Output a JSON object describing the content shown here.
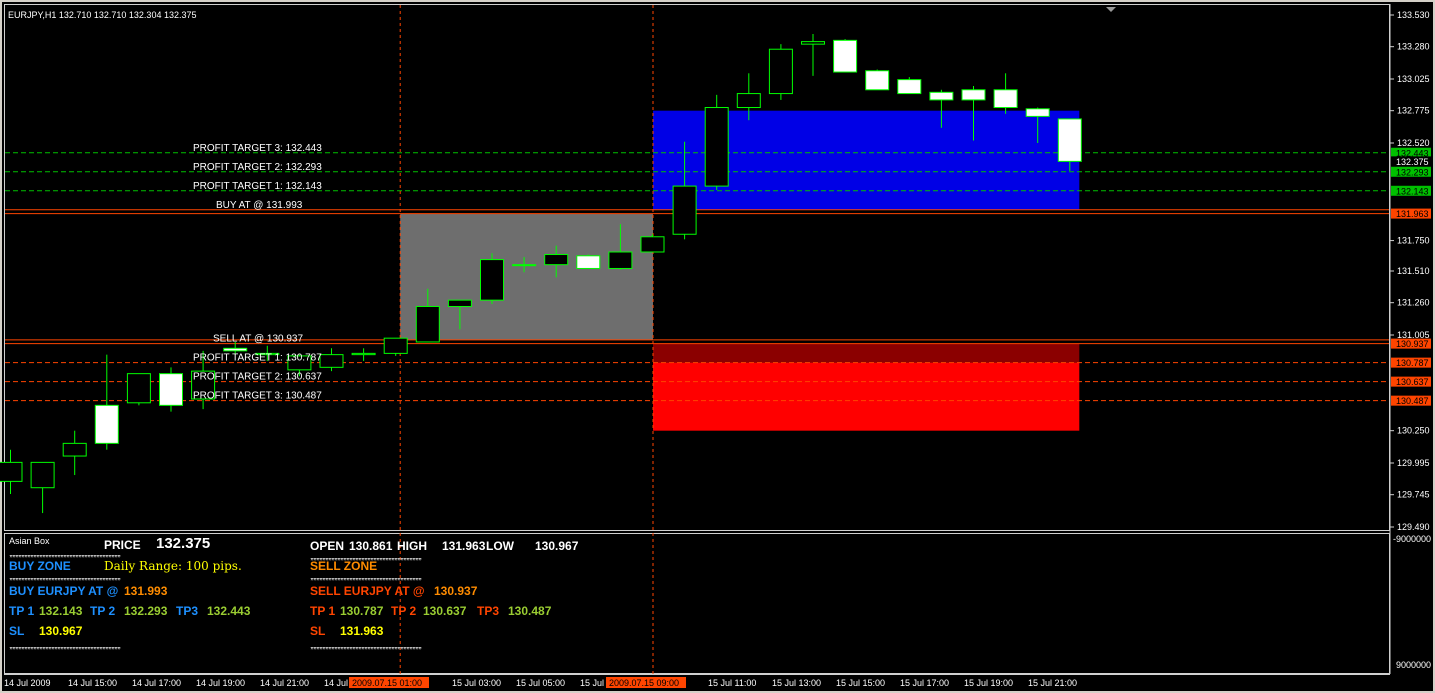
{
  "window": {
    "symbol_header": "EURJPY,H1  132.710 132.710 132.304 132.375"
  },
  "chart_data": {
    "type": "candlestick",
    "symbol": "EURJPY",
    "timeframe": "H1",
    "ylim": [
      129.49,
      133.53
    ],
    "price_ticks": [
      "133.530",
      "133.280",
      "133.025",
      "132.775",
      "132.520",
      "131.750",
      "131.510",
      "131.260",
      "131.005",
      "130.250",
      "129.995",
      "129.745",
      "129.490"
    ],
    "time_labels": [
      "14 Jul 2009",
      "14 Jul 15:00",
      "14 Jul 17:00",
      "14 Jul 19:00",
      "14 Jul 21:00",
      "14 Jul 23:00",
      "15 Jul 03:00",
      "15 Jul 05:00",
      "15 Jul 07:00",
      "15 Jul 11:00",
      "15 Jul 13:00",
      "15 Jul 15:00",
      "15 Jul 17:00",
      "15 Jul 19:00",
      "15 Jul 21:00"
    ],
    "time_markers": [
      "2009.07.15 01:00",
      "2009.07.15 09:00"
    ],
    "candles": [
      {
        "o": 129.85,
        "h": 130.1,
        "l": 129.75,
        "c": 130.0
      },
      {
        "o": 129.8,
        "h": 130.0,
        "l": 129.6,
        "c": 130.0
      },
      {
        "o": 130.05,
        "h": 130.25,
        "l": 129.9,
        "c": 130.15
      },
      {
        "o": 130.45,
        "h": 130.85,
        "l": 130.1,
        "c": 130.15
      },
      {
        "o": 130.47,
        "h": 130.7,
        "l": 130.45,
        "c": 130.7
      },
      {
        "o": 130.7,
        "h": 130.75,
        "l": 130.4,
        "c": 130.45
      },
      {
        "o": 130.5,
        "h": 130.88,
        "l": 130.42,
        "c": 130.72
      },
      {
        "o": 130.9,
        "h": 130.95,
        "l": 130.85,
        "c": 130.88
      },
      {
        "o": 130.85,
        "h": 130.92,
        "l": 130.8,
        "c": 130.86
      },
      {
        "o": 130.73,
        "h": 130.85,
        "l": 130.68,
        "c": 130.84
      },
      {
        "o": 130.75,
        "h": 130.9,
        "l": 130.72,
        "c": 130.85
      },
      {
        "o": 130.85,
        "h": 130.9,
        "l": 130.8,
        "c": 130.86
      },
      {
        "o": 130.86,
        "h": 130.95,
        "l": 130.84,
        "c": 130.98
      },
      {
        "o": 130.95,
        "h": 131.37,
        "l": 130.95,
        "c": 131.23
      },
      {
        "o": 131.23,
        "h": 131.28,
        "l": 131.05,
        "c": 131.28
      },
      {
        "o": 131.28,
        "h": 131.65,
        "l": 131.25,
        "c": 131.6
      },
      {
        "o": 131.56,
        "h": 131.62,
        "l": 131.5,
        "c": 131.56
      },
      {
        "o": 131.56,
        "h": 131.71,
        "l": 131.46,
        "c": 131.64
      },
      {
        "o": 131.63,
        "h": 131.64,
        "l": 131.53,
        "c": 131.53
      },
      {
        "o": 131.53,
        "h": 131.88,
        "l": 131.52,
        "c": 131.66
      },
      {
        "o": 131.66,
        "h": 131.8,
        "l": 131.66,
        "c": 131.78
      },
      {
        "o": 131.8,
        "h": 132.53,
        "l": 131.76,
        "c": 132.18
      },
      {
        "o": 132.18,
        "h": 132.9,
        "l": 132.15,
        "c": 132.8
      },
      {
        "o": 132.8,
        "h": 133.07,
        "l": 132.7,
        "c": 132.91
      },
      {
        "o": 132.91,
        "h": 133.3,
        "l": 132.86,
        "c": 133.26
      },
      {
        "o": 133.3,
        "h": 133.38,
        "l": 133.05,
        "c": 133.32
      },
      {
        "o": 133.33,
        "h": 133.34,
        "l": 133.08,
        "c": 133.08
      },
      {
        "o": 133.09,
        "h": 133.1,
        "l": 132.98,
        "c": 132.94
      },
      {
        "o": 133.02,
        "h": 133.04,
        "l": 132.91,
        "c": 132.91
      },
      {
        "o": 132.92,
        "h": 132.94,
        "l": 132.64,
        "c": 132.86
      },
      {
        "o": 132.94,
        "h": 132.97,
        "l": 132.54,
        "c": 132.86
      },
      {
        "o": 132.94,
        "h": 133.07,
        "l": 132.75,
        "c": 132.8
      },
      {
        "o": 132.79,
        "h": 132.8,
        "l": 132.52,
        "c": 132.73
      },
      {
        "o": 132.71,
        "h": 132.71,
        "l": 132.3,
        "c": 132.375
      }
    ],
    "levels": {
      "buy_at": "131.993",
      "buy_tp1": "132.143",
      "buy_tp2": "132.293",
      "buy_tp3": "132.443",
      "sell_at": "130.937",
      "sell_tp1": "130.787",
      "sell_tp2": "130.637",
      "sell_tp3": "130.487",
      "current": "132.375",
      "high_line": "131.963"
    },
    "chart_labels": [
      {
        "text": "PROFIT TARGET 3: 132.443",
        "price": 132.443
      },
      {
        "text": "PROFIT TARGET 2: 132.293",
        "price": 132.293
      },
      {
        "text": "PROFIT TARGET 1: 132.143",
        "price": 132.143
      },
      {
        "text": "BUY AT @ 131.993",
        "price": 131.993
      },
      {
        "text": "SELL AT @ 130.937",
        "price": 130.937
      },
      {
        "text": "PROFIT TARGET 1: 130.787",
        "price": 130.787
      },
      {
        "text": "PROFIT TARGET 2: 130.637",
        "price": 130.637
      },
      {
        "text": "PROFIT TARGET 3: 130.487",
        "price": 130.487
      }
    ],
    "axis_tags": [
      {
        "text": "132.443",
        "color": "#00c000"
      },
      {
        "text": "132.375",
        "color": "#ffffff"
      },
      {
        "text": "132.293",
        "color": "#00c000"
      },
      {
        "text": "132.143",
        "color": "#00c000"
      },
      {
        "text": "131.963",
        "color": "#ff4500"
      },
      {
        "text": "130.937",
        "color": "#ff4500"
      },
      {
        "text": "130.787",
        "color": "#ff4500"
      },
      {
        "text": "130.637",
        "color": "#ff4500"
      },
      {
        "text": "130.487",
        "color": "#ff4500"
      }
    ],
    "zones": {
      "asian_box_color": "#6e6e6e",
      "buy_zone_color": "#0000e6",
      "sell_zone_top_color": "#8b0000",
      "sell_zone_bottom_color": "#ff0000"
    },
    "grid": false,
    "colors": {
      "up_body": "#000000",
      "down_body": "#ffffff",
      "wick": "#00ff00",
      "bg": "#000000"
    }
  },
  "indicator": {
    "title": "Asian Box",
    "price_label": "PRICE",
    "price_value": "132.375",
    "buy_zone_label": "BUY ZONE",
    "daily_range": "Daily Range: 100 pips.",
    "buy_at_label": "BUY EURJPY AT @",
    "buy_at_value": "131.993",
    "tp1_label": "TP 1",
    "tp1_value": "132.143",
    "tp2_label": "TP 2",
    "tp2_value": "132.293",
    "tp3_label": "TP3",
    "tp3_value": "132.443",
    "sl_label": "SL",
    "sl_value": "130.967",
    "open_label": "OPEN",
    "open_value": "130.861",
    "high_label": "HIGH",
    "high_value": "131.963",
    "low_label": "LOW",
    "low_value": "130.967",
    "sell_zone_label": "SELL ZONE",
    "sell_at_label": "SELL EURJPY AT @",
    "sell_at_value": "130.937",
    "stp1_label": "TP 1",
    "stp1_value": "130.787",
    "stp2_label": "TP 2",
    "stp2_value": "130.637",
    "stp3_label": "TP3",
    "stp3_value": "130.487",
    "ssl_label": "SL",
    "ssl_value": "131.963",
    "axis_top": "-9000000",
    "axis_bottom": "9000000",
    "dots": ",,,,,,,,,,,,,,,,,,,,,,,,,,,,,,,,,,,,,,,,,,,,,,,,,,,,,,,,,,,,,,,,,,,,,,,,,,"
  }
}
